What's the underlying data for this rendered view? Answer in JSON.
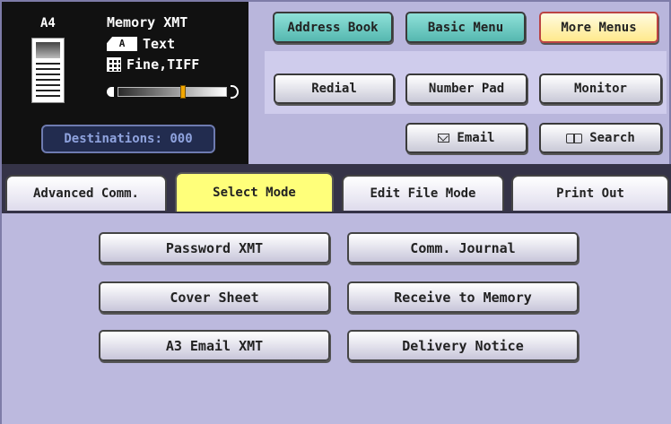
{
  "status": {
    "paper_size": "A4",
    "mode": "Memory XMT",
    "original_type_icon": "A",
    "original_type": "Text",
    "resolution": "Fine,TIFF",
    "density_level": 0.6,
    "destinations": "Destinations: 000"
  },
  "top_buttons": {
    "address_book": "Address Book",
    "basic_menu": "Basic Menu",
    "more_menus": "More Menus",
    "redial": "Redial",
    "number_pad": "Number Pad",
    "monitor": "Monitor",
    "email": "Email",
    "search": "Search"
  },
  "tabs": [
    {
      "label": "Advanced Comm."
    },
    {
      "label": "Select Mode"
    },
    {
      "label": "Edit File Mode"
    },
    {
      "label": "Print Out"
    }
  ],
  "active_tab": "Select Mode",
  "options": {
    "password_xmt": "Password XMT",
    "comm_journal": "Comm. Journal",
    "cover_sheet": "Cover Sheet",
    "receive_to_memory": "Receive to Memory",
    "a3_email_xmt": "A3 Email XMT",
    "delivery_notice": "Delivery Notice"
  },
  "colors": {
    "panel_bg": "#b9b6dc",
    "status_bg": "#111111",
    "active_tab": "#ffff7a",
    "teal_button": "#55b8b0",
    "density_marker": "#f2a800"
  },
  "icons": [
    "document-thumbnail-icon",
    "text-mode-icon",
    "resolution-grid-icon",
    "envelope-icon",
    "book-icon"
  ]
}
